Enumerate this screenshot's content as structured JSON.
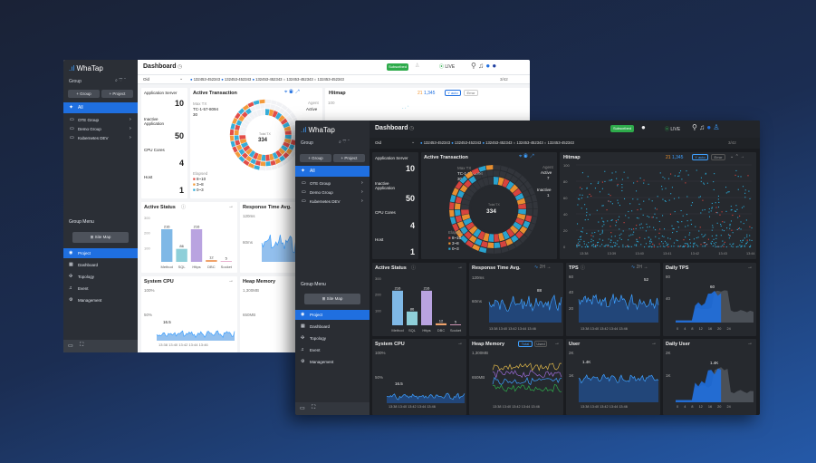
{
  "brand": "WhaTap",
  "colors": {
    "accent": "#1f6fe0",
    "green": "#2eab4b",
    "orange": "#f29530",
    "red": "#e0453f",
    "cyan": "#2aa9d6"
  },
  "sidebar": {
    "group_label": "Group",
    "add_group": "+ Group",
    "add_project": "+ Project",
    "all": "All",
    "groups": [
      "OTE Group",
      "Demo Group",
      "Kubernetes DEV"
    ],
    "menu_title": "Group Menu",
    "site_map": "Site Map",
    "nav": [
      "Project",
      "Dashboard",
      "Topology",
      "Event",
      "Management"
    ]
  },
  "header": {
    "title": "Dashboard",
    "subscribed": "Subscribed",
    "live": "LIVE",
    "filter": "Oid",
    "oids": [
      "132453-452343",
      "132453-452343",
      "132453-452343",
      "132453-452343",
      "132453-452343"
    ],
    "page": "3/42"
  },
  "stats": {
    "app_server_label": "Application Server",
    "app_server": "10",
    "inactive_label": "Inactive Application",
    "inactive": "50",
    "cpu_label": "CPU Cores",
    "cpu": "4",
    "host_label": "Host",
    "host": "1"
  },
  "active_tx": {
    "title": "Active Transaction",
    "max_label": "Max TX",
    "max_id": "TC-1-57-8094",
    "max_val": "30",
    "total_label": "Total TX",
    "total": "334",
    "agent_label": "Agent",
    "active_label": "Active",
    "active": "7",
    "inactive_label": "Inactive",
    "inactive": "1",
    "elapsed_label": "Elapsed",
    "legend": [
      "8~10",
      "3~8",
      "0~3"
    ]
  },
  "hitmap": {
    "title": "Hitmap",
    "count1": "21",
    "count2": "1,345",
    "auto": "Y auto",
    "error": "Error",
    "y_ticks": [
      "100",
      "80",
      "60",
      "40",
      "20",
      "0"
    ],
    "x_ticks": [
      "13:38",
      "13:39",
      "13:40",
      "13:41",
      "13:42",
      "13:43",
      "13:44"
    ]
  },
  "active_status": {
    "title": "Active Status",
    "y_ticks": [
      "300",
      "200",
      "100"
    ],
    "categories": [
      "Method",
      "SQL",
      "Https",
      "DBC",
      "Socket"
    ],
    "values": [
      216,
      86,
      216,
      12,
      5
    ]
  },
  "response_time": {
    "title": "Response Time Avg.",
    "range": "2H",
    "y_ticks": [
      "120ms",
      "60ms"
    ],
    "peak": "88",
    "x_ticks": [
      "13:38",
      "13:40",
      "13:42",
      "13:44",
      "13:46"
    ]
  },
  "tps": {
    "title": "TPS",
    "range": "2H",
    "y_ticks": [
      "60",
      "40",
      "20"
    ],
    "peak": "52",
    "x_ticks": [
      "13:38",
      "13:40",
      "13:42",
      "13:44",
      "13:46"
    ]
  },
  "daily_tps": {
    "title": "Daily TPS",
    "y_ticks": [
      "80",
      "40"
    ],
    "peak": "60",
    "x_ticks": [
      "0",
      "4",
      "8",
      "12",
      "16",
      "20",
      "24"
    ]
  },
  "system_cpu": {
    "title": "System CPU",
    "y_ticks": [
      "100%",
      "50%"
    ],
    "peak": "16.5",
    "x_ticks": [
      "13:38",
      "13:40",
      "13:42",
      "13:44",
      "13:46"
    ]
  },
  "heap": {
    "title": "Heap Memory",
    "total": "Total",
    "used": "Used",
    "y_ticks": [
      "1,300MB",
      "650MB"
    ],
    "x_ticks": [
      "13:38",
      "13:40",
      "13:42",
      "13:44",
      "13:46"
    ]
  },
  "user": {
    "title": "User",
    "y_ticks": [
      "2K",
      "1K"
    ],
    "peak": "1.4K",
    "x_ticks": [
      "13:38",
      "13:40",
      "13:42",
      "13:44",
      "13:46"
    ]
  },
  "daily_user": {
    "title": "Daily User",
    "y_ticks": [
      "2K",
      "1K"
    ],
    "peak": "1.4K",
    "x_ticks": [
      "0",
      "4",
      "8",
      "12",
      "16",
      "20",
      "24"
    ]
  }
}
